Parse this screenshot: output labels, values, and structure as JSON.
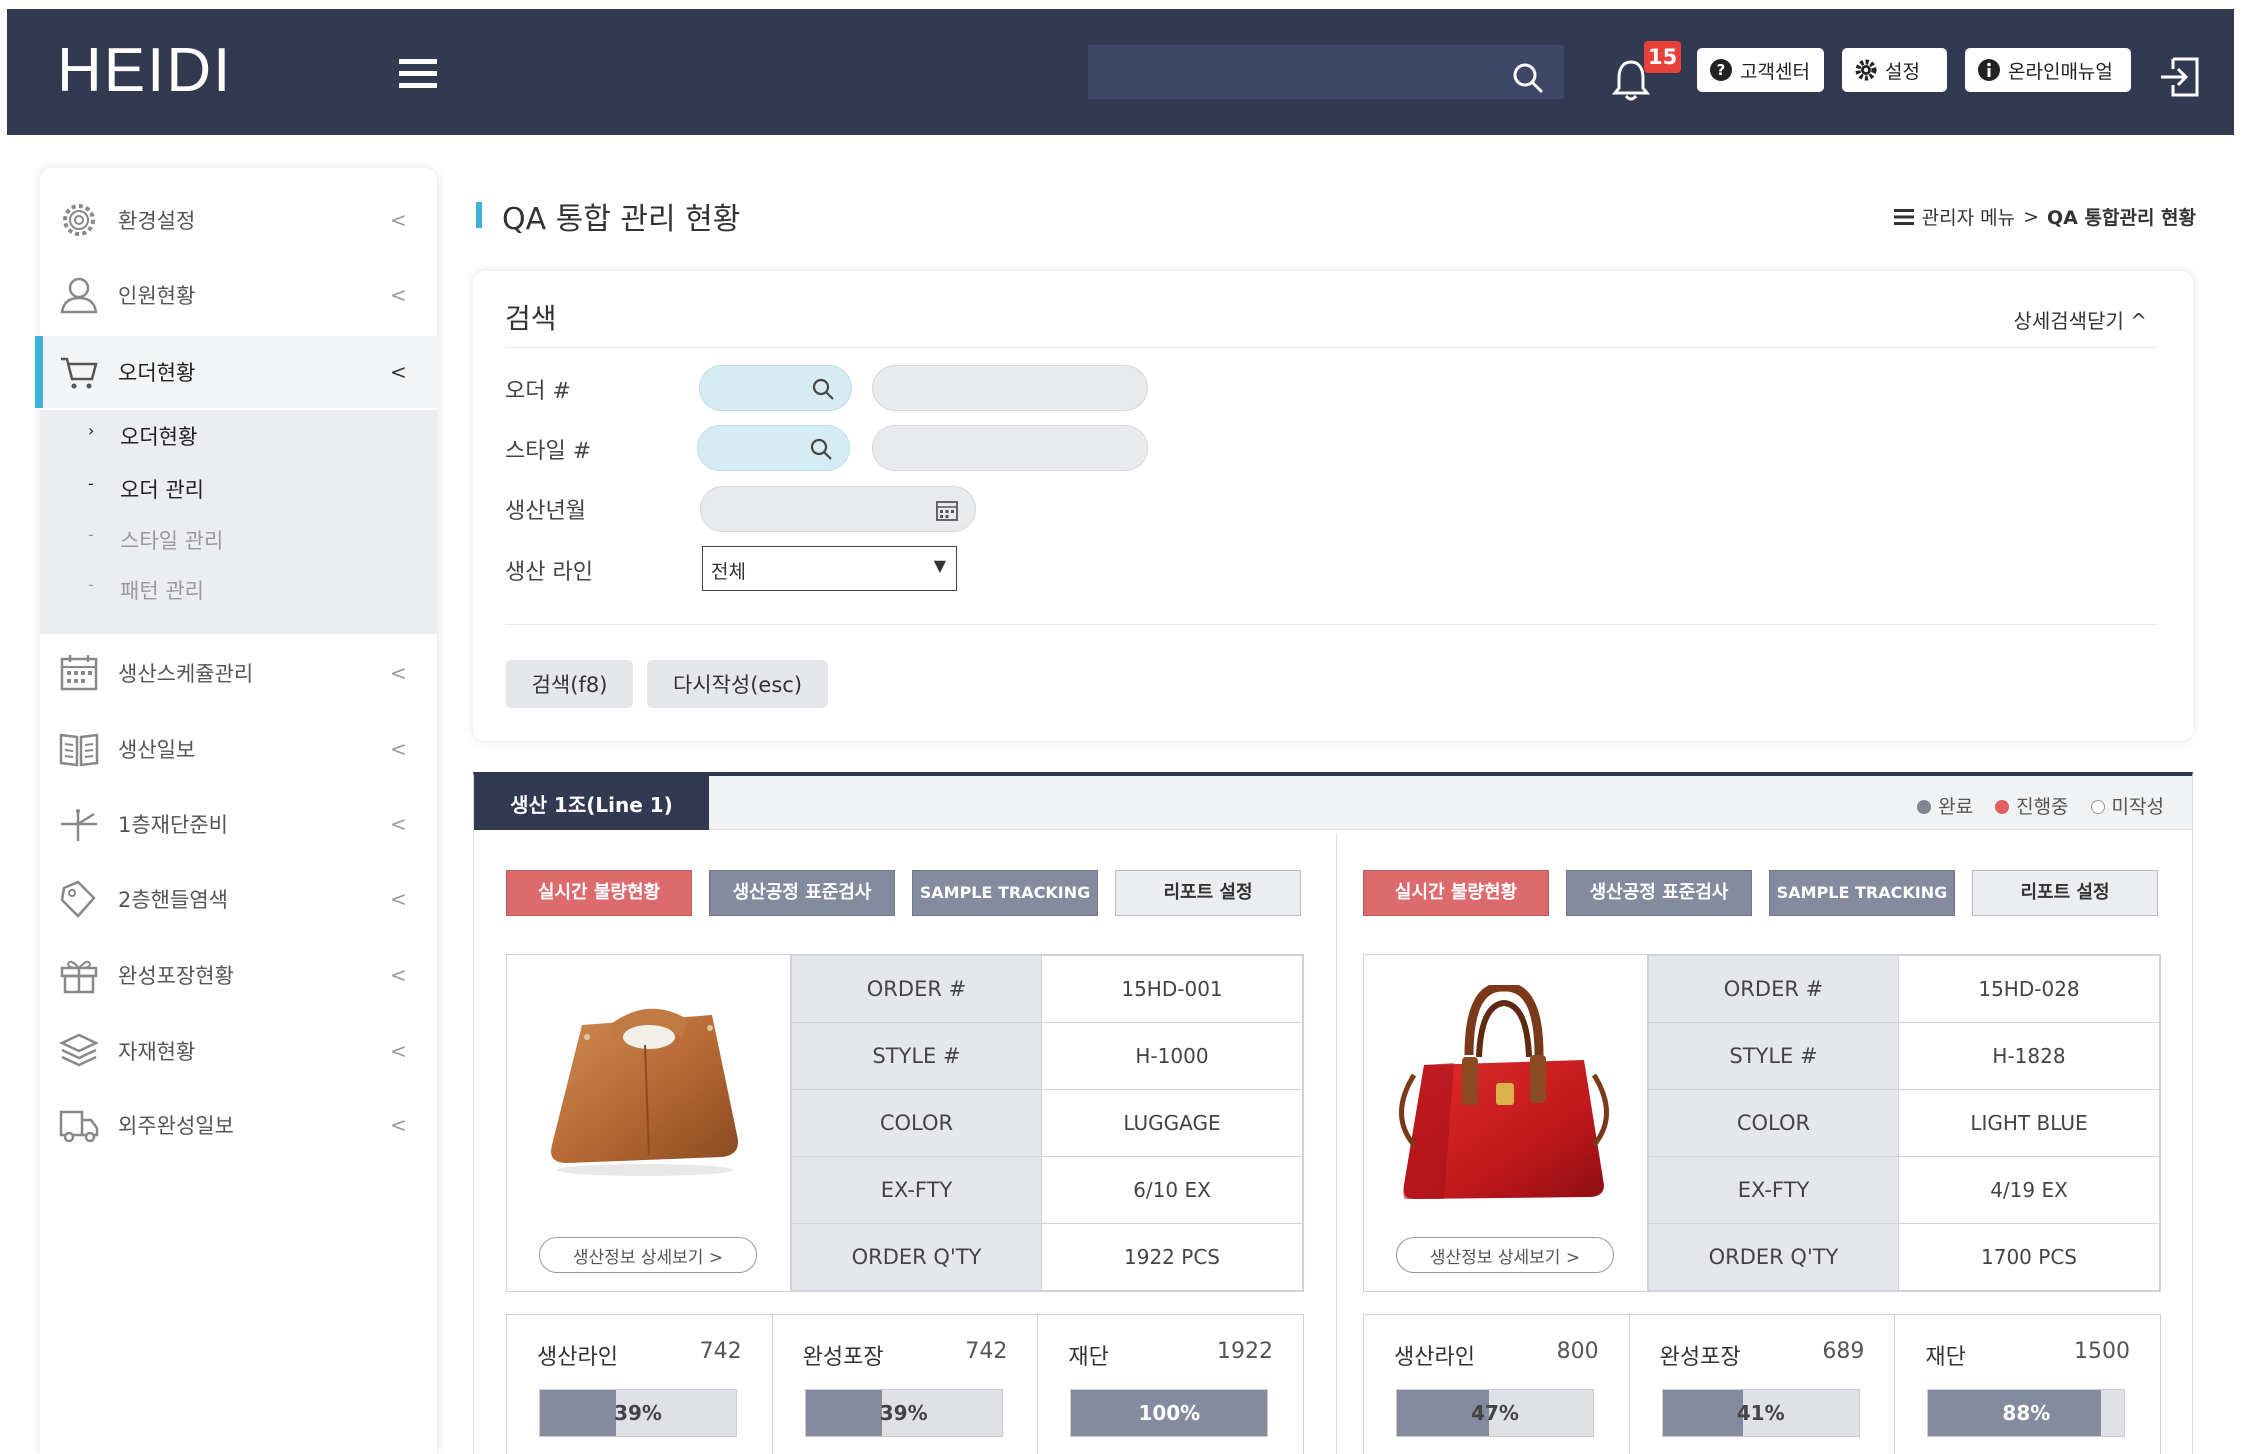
{
  "header": {
    "logo": "HEIDI",
    "notification_count": "15",
    "buttons": [
      {
        "label": "고객센터",
        "icon": "question-icon"
      },
      {
        "label": "설정",
        "icon": "gear-icon"
      },
      {
        "label": "온라인매뉴얼",
        "icon": "info-icon"
      }
    ]
  },
  "sidebar": {
    "items": [
      {
        "label": "환경설정",
        "icon": "gear-icon"
      },
      {
        "label": "인원현황",
        "icon": "user-icon"
      },
      {
        "label": "오더현황",
        "icon": "cart-icon",
        "active": true
      },
      {
        "label": "생산스케쥴관리",
        "icon": "calendar-icon"
      },
      {
        "label": "생산일보",
        "icon": "book-icon"
      },
      {
        "label": "1층재단준비",
        "icon": "scissors-icon"
      },
      {
        "label": "2층핸들염색",
        "icon": "tag-icon"
      },
      {
        "label": "완성포장현황",
        "icon": "gift-icon"
      },
      {
        "label": "자재현황",
        "icon": "layers-icon"
      },
      {
        "label": "외주완성일보",
        "icon": "truck-icon"
      }
    ],
    "submenu": [
      {
        "marker": "›",
        "label": "오더현황",
        "current": true
      },
      {
        "marker": "-",
        "label": "오더 관리",
        "current": true
      },
      {
        "marker": "-",
        "label": "스타일 관리",
        "current": false
      },
      {
        "marker": "-",
        "label": "패턴 관리",
        "current": false
      }
    ]
  },
  "page": {
    "title": "QA 통합 관리 현황",
    "breadcrumb_root": "관리자 메뉴",
    "breadcrumb_sep": ">",
    "breadcrumb_current": "QA 통합관리 현황"
  },
  "search": {
    "title": "검색",
    "toggle_label": "상세검색닫기 ^",
    "fields": {
      "order_label": "오더 #",
      "style_label": "스타일 #",
      "date_label": "생산년월",
      "line_label": "생산 라인",
      "line_value": "전체"
    },
    "search_button": "검색(f8)",
    "reset_button": "다시작성(esc)"
  },
  "line_panel": {
    "tab_label": "생산 1조(Line 1)",
    "legend": [
      {
        "label": "완료",
        "color": "#7f8593"
      },
      {
        "label": "진행중",
        "color": "#e0605f"
      },
      {
        "label": "미작성",
        "color": "#ffffff"
      }
    ],
    "action_buttons": [
      "실시간 불량현황",
      "생산공정 표준검사",
      "SAMPLE TRACKING",
      "리포트 설정"
    ],
    "detail_button": "생산정보 상세보기 >",
    "row_keys": [
      "ORDER #",
      "STYLE #",
      "COLOR",
      "EX-FTY",
      "ORDER Q'TY"
    ],
    "cards": [
      {
        "image": "brown-leather-handbag",
        "values": [
          "15HD-001",
          "H-1000",
          "LUGGAGE",
          "6/10 EX",
          "1922 PCS"
        ],
        "stats": [
          {
            "name": "생산라인",
            "value": "742",
            "percent": 39,
            "percent_label": "39%"
          },
          {
            "name": "완성포장",
            "value": "742",
            "percent": 39,
            "percent_label": "39%"
          },
          {
            "name": "재단",
            "value": "1922",
            "percent": 100,
            "percent_label": "100%"
          }
        ]
      },
      {
        "image": "red-leather-handbag",
        "values": [
          "15HD-028",
          "H-1828",
          "LIGHT BLUE",
          "4/19 EX",
          "1700 PCS"
        ],
        "stats": [
          {
            "name": "생산라인",
            "value": "800",
            "percent": 47,
            "percent_label": "47%"
          },
          {
            "name": "완성포장",
            "value": "689",
            "percent": 41,
            "percent_label": "41%"
          },
          {
            "name": "재단",
            "value": "1500",
            "percent": 88,
            "percent_label": "88%"
          }
        ]
      }
    ]
  },
  "colors": {
    "header_bg": "#323a52",
    "accent": "#3fb1d7",
    "danger": "#dd6b6e",
    "progress": "#848b9e"
  }
}
